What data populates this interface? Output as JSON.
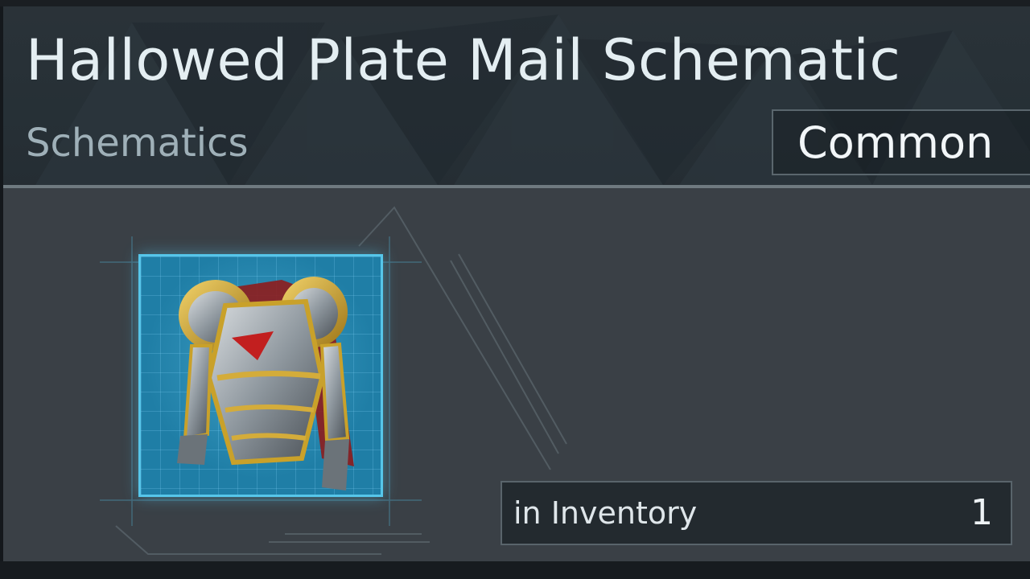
{
  "item": {
    "title": "Hallowed Plate Mail Schematic",
    "category": "Schematics",
    "rarity": "Common",
    "icon": "plate-armor-icon"
  },
  "inventory": {
    "label": "in Inventory",
    "count": "1"
  },
  "colors": {
    "header_bg": "#263036",
    "panel_bg": "#3a4046",
    "frame_accent": "#56c6ea",
    "armor_gold": "#c9a12a",
    "armor_steel": "#9aa3ab",
    "armor_red": "#c21f1f"
  }
}
